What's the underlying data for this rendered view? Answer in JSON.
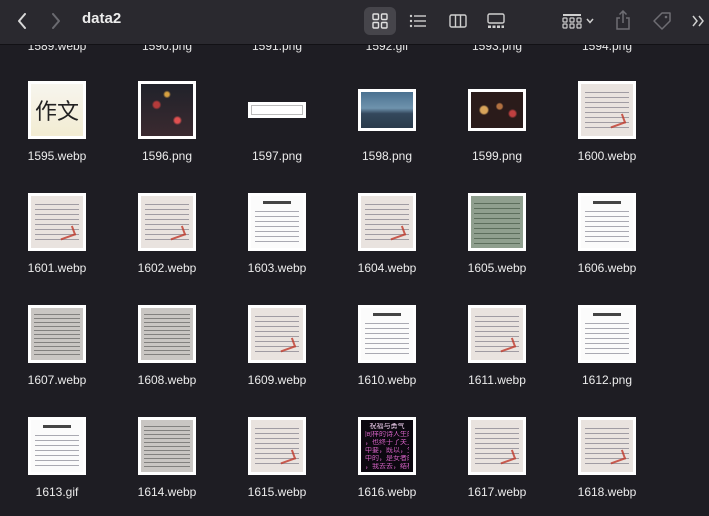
{
  "window": {
    "title": "data2"
  },
  "toolbar": {
    "back_icon": "chevron-left-icon",
    "forward_icon": "chevron-right-icon",
    "views": [
      "icon-view-icon",
      "list-view-icon",
      "column-view-icon",
      "gallery-view-icon"
    ],
    "selected_view": "icon-view-icon",
    "group_icon": "grid-group-icon",
    "share_icon": "share-icon",
    "tags_icon": "tag-icon",
    "more_icon": "chevrons-right-icon"
  },
  "partial_row": [
    "1589.webp",
    "1590.png",
    "1591.png",
    "1592.gif",
    "1593.png",
    "1594.png"
  ],
  "files": [
    {
      "name": "1595.webp",
      "kind": "zw"
    },
    {
      "name": "1596.png",
      "kind": "night"
    },
    {
      "name": "1597.png",
      "kind": "blank"
    },
    {
      "name": "1598.png",
      "kind": "mountain"
    },
    {
      "name": "1599.png",
      "kind": "bokeh"
    },
    {
      "name": "1600.webp",
      "kind": "paper"
    },
    {
      "name": "1601.webp",
      "kind": "paper"
    },
    {
      "name": "1602.webp",
      "kind": "paper"
    },
    {
      "name": "1603.webp",
      "kind": "doc"
    },
    {
      "name": "1604.webp",
      "kind": "paper"
    },
    {
      "name": "1605.webp",
      "kind": "green"
    },
    {
      "name": "1606.webp",
      "kind": "doc"
    },
    {
      "name": "1607.webp",
      "kind": "gray"
    },
    {
      "name": "1608.webp",
      "kind": "gray"
    },
    {
      "name": "1609.webp",
      "kind": "paper"
    },
    {
      "name": "1610.webp",
      "kind": "doc"
    },
    {
      "name": "1611.webp",
      "kind": "paper"
    },
    {
      "name": "1612.png",
      "kind": "doc"
    },
    {
      "name": "1613.gif",
      "kind": "doc"
    },
    {
      "name": "1614.webp",
      "kind": "gray"
    },
    {
      "name": "1615.webp",
      "kind": "paper"
    },
    {
      "name": "1616.webp",
      "kind": "dark"
    },
    {
      "name": "1617.webp",
      "kind": "paper"
    },
    {
      "name": "1618.webp",
      "kind": "paper"
    }
  ],
  "thumb_text": {
    "zuowen": "作文",
    "dark_lines": [
      "祝福与勇气",
      "同样的诗人生的",
      "，也终于了关上",
      "中要，既以，生好",
      "中的，是女者的",
      "，我去去，结样"
    ]
  }
}
